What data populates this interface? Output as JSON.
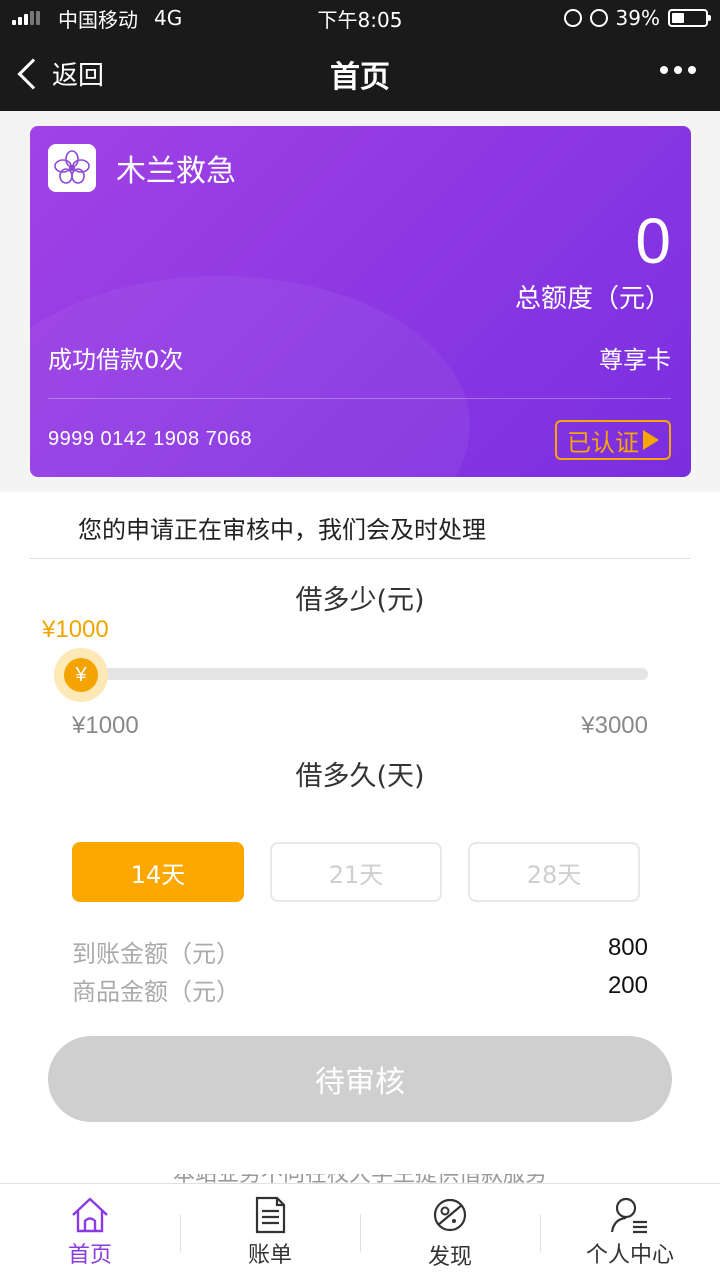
{
  "status_bar": {
    "carrier": "中国移动",
    "network": "4G",
    "time": "下午8:05",
    "battery": "39%",
    "battery_level": 0.39
  },
  "nav": {
    "back_label": "返回",
    "title": "首页"
  },
  "card": {
    "name": "木兰救急",
    "total_amount": "0",
    "total_label": "总额度（元）",
    "loans_text": "成功借款0次",
    "card_type": "尊享卡",
    "card_number": "9999 0142 1908 7068",
    "verified_label": "已认证",
    "gradient_start": "#a142e6",
    "gradient_end": "#7a2ee0"
  },
  "notice": "您的申请正在审核中，我们会及时处理",
  "amount_section": {
    "title": "借多少(元)",
    "current_value": "¥1000",
    "thumb_symbol": "¥",
    "min_label": "¥1000",
    "max_label": "¥3000",
    "slider_fraction": 0
  },
  "term_section": {
    "title": "借多久(天)",
    "options": [
      {
        "label": "14天",
        "selected": true
      },
      {
        "label": "21天",
        "selected": false
      },
      {
        "label": "28天",
        "selected": false
      }
    ]
  },
  "summary": [
    {
      "label": "到账金额（元）",
      "value": "800"
    },
    {
      "label": "商品金额（元）",
      "value": "200"
    }
  ],
  "submit_label": "待审核",
  "footer_note": "本站业务不向在校大学生提供借款服务",
  "tabs": [
    {
      "label": "首页",
      "icon": "home-icon",
      "active": true
    },
    {
      "label": "账单",
      "icon": "bill-icon",
      "active": false
    },
    {
      "label": "发现",
      "icon": "discover-icon",
      "active": false
    },
    {
      "label": "个人中心",
      "icon": "user-icon",
      "active": false
    }
  ],
  "colors": {
    "accent": "#fca800",
    "brand": "#8a3be3",
    "disabled": "#cfcfcf"
  }
}
